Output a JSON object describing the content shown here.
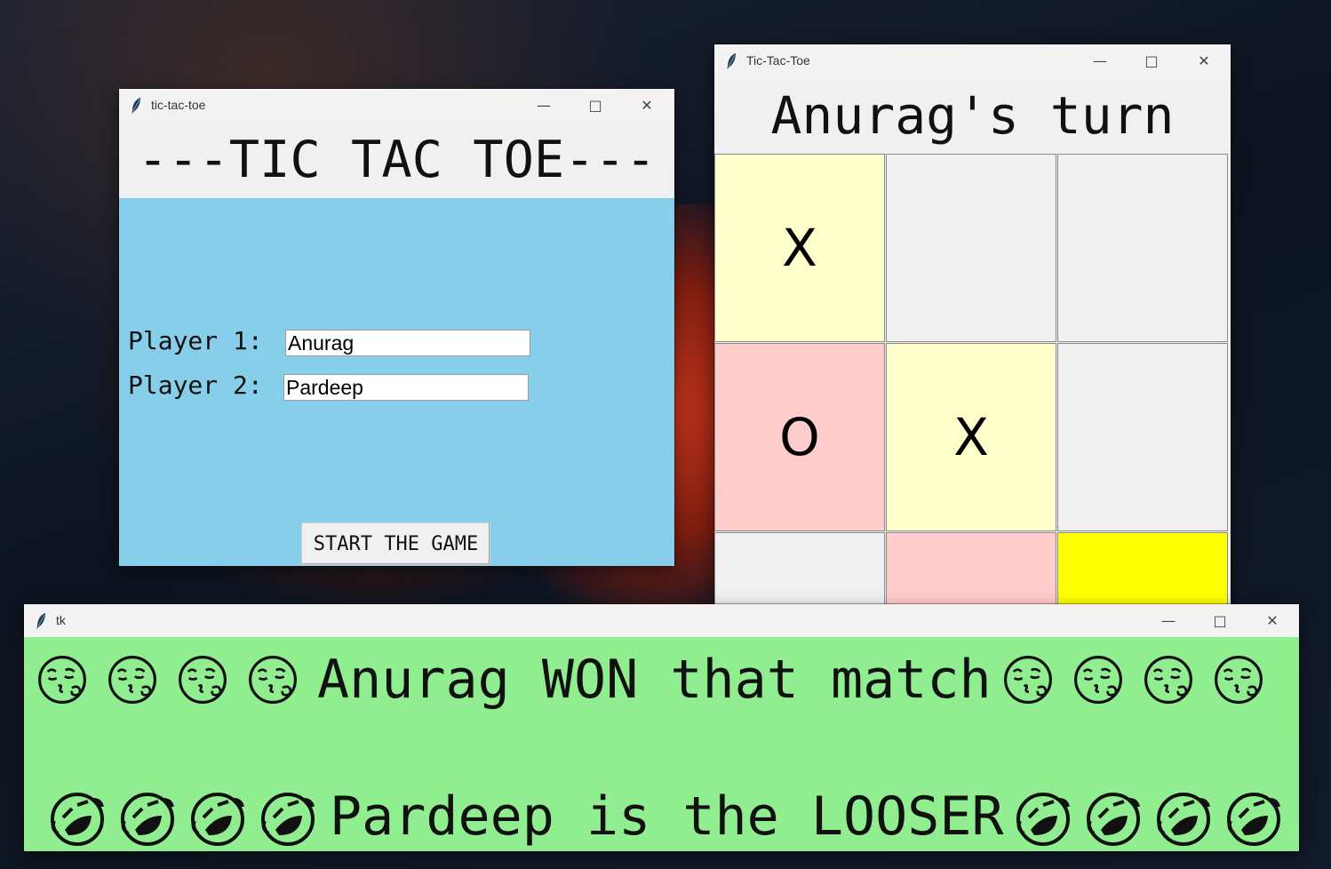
{
  "window1": {
    "title": "tic-tac-toe",
    "banner": "---TIC TAC TOE---",
    "player1_label": "Player 1:",
    "player1_value": "Anurag",
    "player2_label": "Player 2:",
    "player2_value": "Pardeep",
    "start_button": "START THE GAME"
  },
  "window2": {
    "title": "Tic-Tac-Toe",
    "turn_text": "Anurag's turn",
    "cells": [
      {
        "mark": "X",
        "color": "#ffffcc"
      },
      {
        "mark": "",
        "color": "#f0f0f0"
      },
      {
        "mark": "",
        "color": "#f0f0f0"
      },
      {
        "mark": "O",
        "color": "#ffcccc"
      },
      {
        "mark": "X",
        "color": "#ffffcc"
      },
      {
        "mark": "",
        "color": "#f0f0f0"
      },
      {
        "mark": "",
        "color": "#f0f0f0"
      },
      {
        "mark": "",
        "color": "#ffcccc"
      },
      {
        "mark": "",
        "color": "#ffff00"
      }
    ]
  },
  "window3": {
    "title": "tk",
    "winner_text": "Anurag WON that match",
    "loser_text": "Pardeep is the LOOSER",
    "winner_emoji": "kissing-face-icon",
    "loser_emoji": "rolling-laughing-face-icon"
  },
  "window_controls": {
    "minimize": "minimize-icon",
    "maximize": "maximize-icon",
    "close": "close-icon"
  },
  "colors": {
    "form_bg": "#87ceeb",
    "result_bg": "#90ee90",
    "x_cell": "#ffffcc",
    "o_cell": "#ffcccc",
    "highlight_cell": "#ffff00"
  }
}
